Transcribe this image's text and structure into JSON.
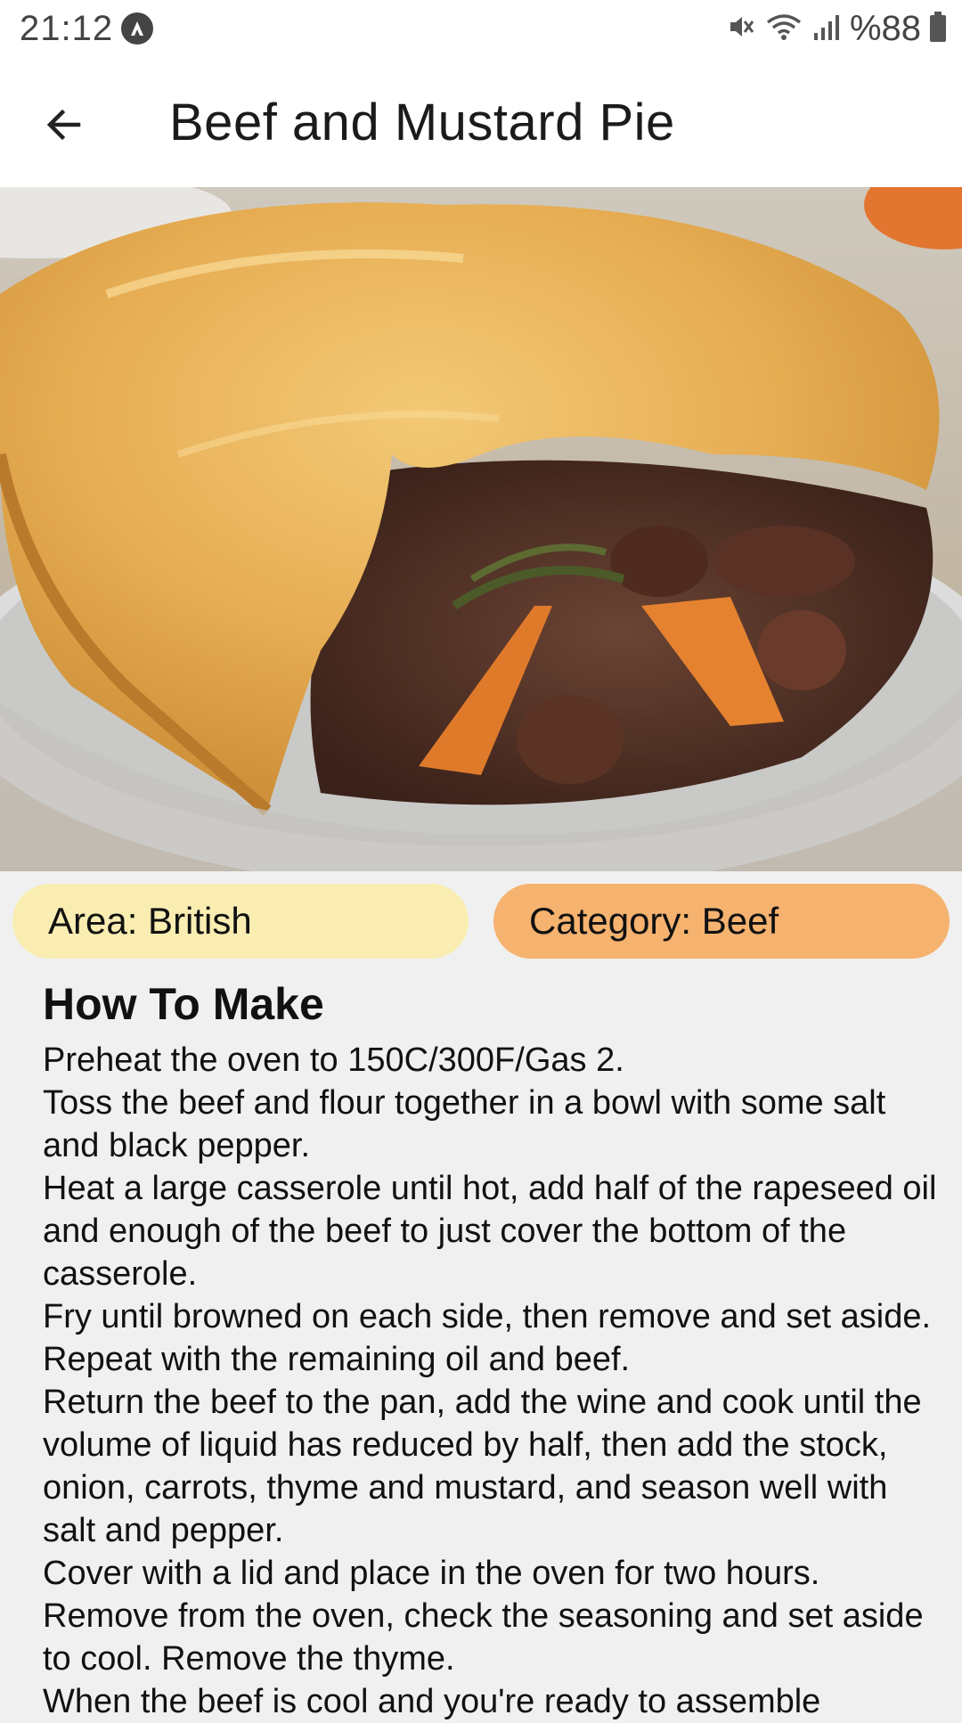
{
  "status_bar": {
    "time": "21:12",
    "battery": "%88",
    "icons": [
      "app-notification-icon",
      "mute-icon",
      "wifi-icon",
      "signal-icon",
      "battery-icon"
    ]
  },
  "app_bar": {
    "title": "Beef and Mustard Pie",
    "back_icon": "arrow-back-icon"
  },
  "chips": {
    "area": "Area: British",
    "category": "Category: Beef",
    "colors": {
      "area": "#f9edb2",
      "category": "#f6b26f"
    }
  },
  "section": {
    "title": "How To Make"
  },
  "instructions": [
    "Preheat the oven to 150C/300F/Gas 2.",
    "Toss the beef and flour together in a bowl with some salt and black pepper.",
    "Heat a large casserole until hot, add half of the rapeseed oil and enough of the beef to just cover the bottom of the casserole.",
    "Fry until browned on each side, then remove and set aside. Repeat with the remaining oil and beef.",
    "Return the beef to the pan, add the wine and cook until the volume of liquid has reduced by half, then add the stock, onion, carrots, thyme and mustard, and season well with salt and pepper.",
    "Cover with a lid and place in the oven for two hours.",
    "Remove from the oven, check the seasoning and set aside to cool. Remove the thyme.",
    "When the beef is cool and you're ready to assemble"
  ]
}
